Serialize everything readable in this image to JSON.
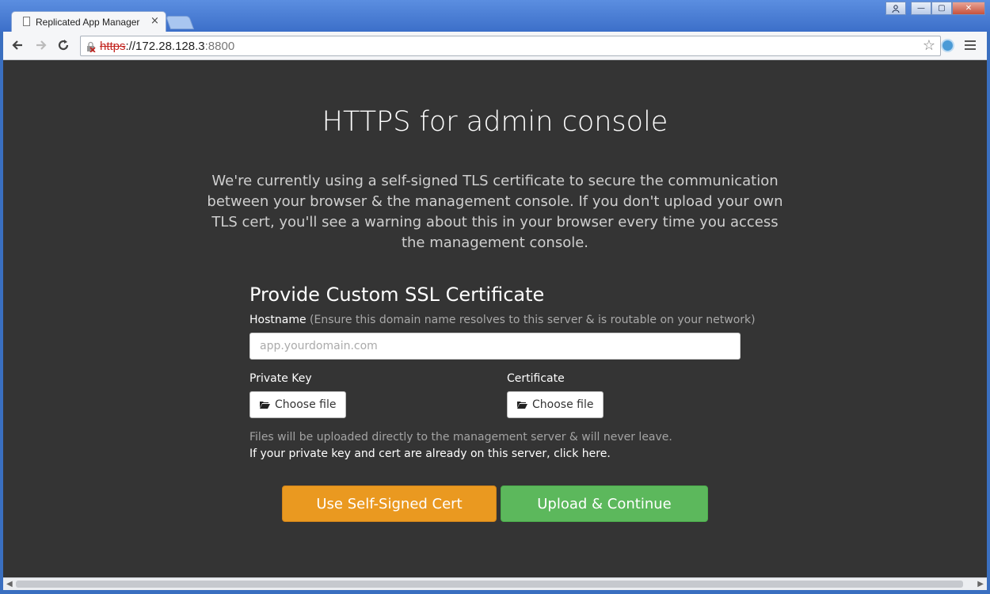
{
  "browser": {
    "tab_title": "Replicated App Manager",
    "tab_close": "×",
    "url_scheme": "https",
    "url_host": "://172.28.128.3",
    "url_port": ":8800",
    "window_controls": {
      "minimize": "—",
      "maximize": "▢",
      "close": "✕"
    }
  },
  "page": {
    "title": "HTTPS for admin console",
    "intro": "We're currently using a self-signed TLS certificate to secure the communication between your browser & the management console. If you don't upload your own TLS cert, you'll see a warning about this in your browser every time you access the management console.",
    "section_title": "Provide Custom SSL Certificate",
    "hostname_label": "Hostname",
    "hostname_hint": " (Ensure this domain name resolves to this server & is routable on your network)",
    "hostname_placeholder": "app.yourdomain.com",
    "hostname_value": "",
    "private_key_label": "Private Key",
    "certificate_label": "Certificate",
    "choose_file_label": "Choose file",
    "files_note": "Files will be uploaded directly to the management server & will never leave.",
    "already_on_server_link": "If your private key and cert are already on this server, click here.",
    "self_signed_button": "Use Self-Signed Cert",
    "upload_button": "Upload & Continue"
  },
  "colors": {
    "page_background": "#343434",
    "self_signed_button": "#ea9920",
    "upload_button": "#5cb85c",
    "insecure_scheme": "#c2241f"
  },
  "icons": [
    "page-icon",
    "back-icon",
    "forward-icon",
    "reload-icon",
    "insecure-lock-icon",
    "star-icon",
    "extension-icon",
    "menu-icon",
    "folder-open-icon",
    "user-icon"
  ]
}
